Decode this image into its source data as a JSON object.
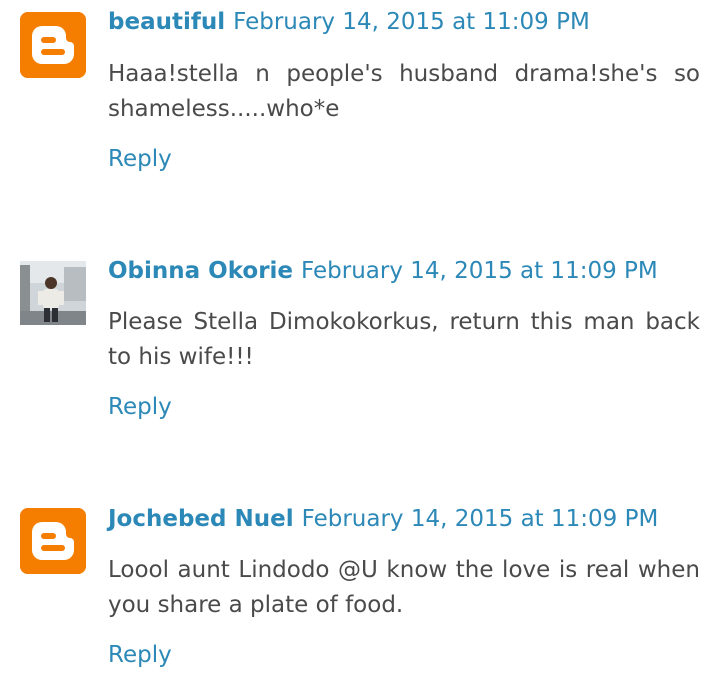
{
  "comments": [
    {
      "author": "beautiful",
      "timestamp": "February 14, 2015 at 11:09 PM",
      "text": "Haaa!stella n people's husband drama!she's so shameless.....who*e",
      "reply_label": "Reply",
      "avatar": "blogger-logo-icon"
    },
    {
      "author": "Obinna Okorie",
      "timestamp": "February 14, 2015 at 11:09 PM",
      "text": "Please Stella Dimokokorkus, return this man back to his wife!!!",
      "reply_label": "Reply",
      "avatar": "user-photo"
    },
    {
      "author": "Jochebed Nuel",
      "timestamp": "February 14, 2015 at 11:09 PM",
      "text": "Loool aunt Lindodo @U know the love is real when you share a plate of food.",
      "reply_label": "Reply",
      "avatar": "blogger-logo-icon"
    }
  ],
  "colors": {
    "link": "#2b88b7",
    "text": "#4a4a4a",
    "blogger_orange": "#f57d00"
  }
}
